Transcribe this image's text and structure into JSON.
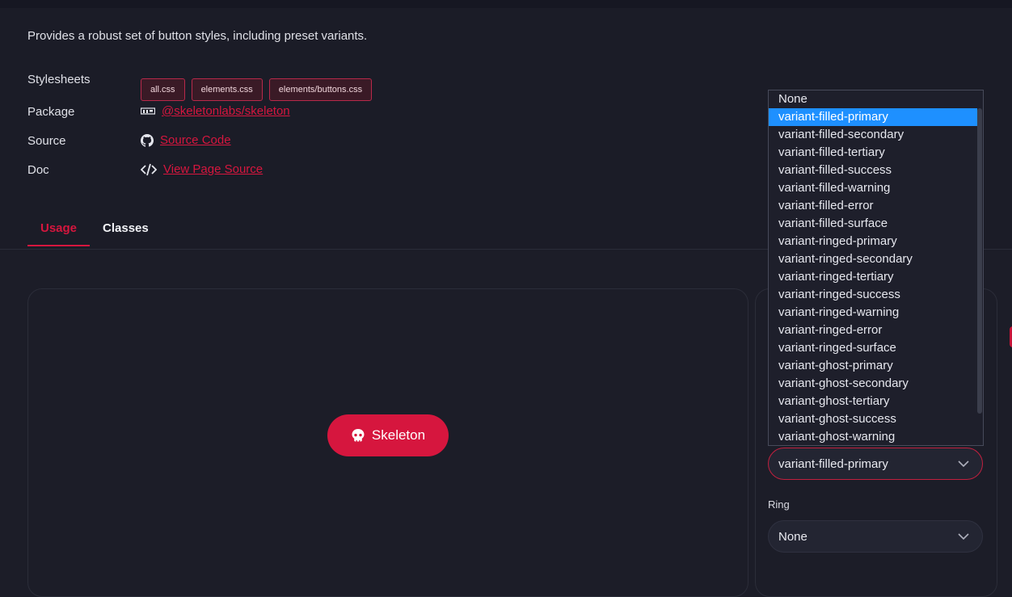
{
  "description": "Provides a robust set of button styles, including preset variants.",
  "meta": {
    "stylesheets_label": "Stylesheets",
    "stylesheets": [
      "all.css",
      "elements.css",
      "elements/buttons.css"
    ],
    "package_label": "Package",
    "package_link": "@skeletonlabs/skeleton",
    "source_label": "Source",
    "source_link": "Source Code",
    "doc_label": "Doc",
    "doc_link": "View Page Source"
  },
  "tabs": [
    {
      "label": "Usage",
      "active": true
    },
    {
      "label": "Classes",
      "active": false
    }
  ],
  "preview": {
    "button_label": "Skeleton"
  },
  "controls": {
    "preset_value": "variant-filled-primary",
    "ring_label": "Ring",
    "ring_value": "None"
  },
  "dropdown": {
    "selected": "variant-filled-primary",
    "options": [
      "None",
      "variant-filled-primary",
      "variant-filled-secondary",
      "variant-filled-tertiary",
      "variant-filled-success",
      "variant-filled-warning",
      "variant-filled-error",
      "variant-filled-surface",
      "variant-ringed-primary",
      "variant-ringed-secondary",
      "variant-ringed-tertiary",
      "variant-ringed-success",
      "variant-ringed-warning",
      "variant-ringed-error",
      "variant-ringed-surface",
      "variant-ghost-primary",
      "variant-ghost-secondary",
      "variant-ghost-tertiary",
      "variant-ghost-success",
      "variant-ghost-warning"
    ]
  },
  "colors": {
    "accent": "#d6163e",
    "background": "#1c1d28",
    "highlight": "#1e90ff"
  },
  "icons": {
    "package": "npm-icon",
    "source": "github-icon",
    "doc": "code-icon",
    "button": "skull-icon",
    "select": "chevron-down-icon"
  }
}
